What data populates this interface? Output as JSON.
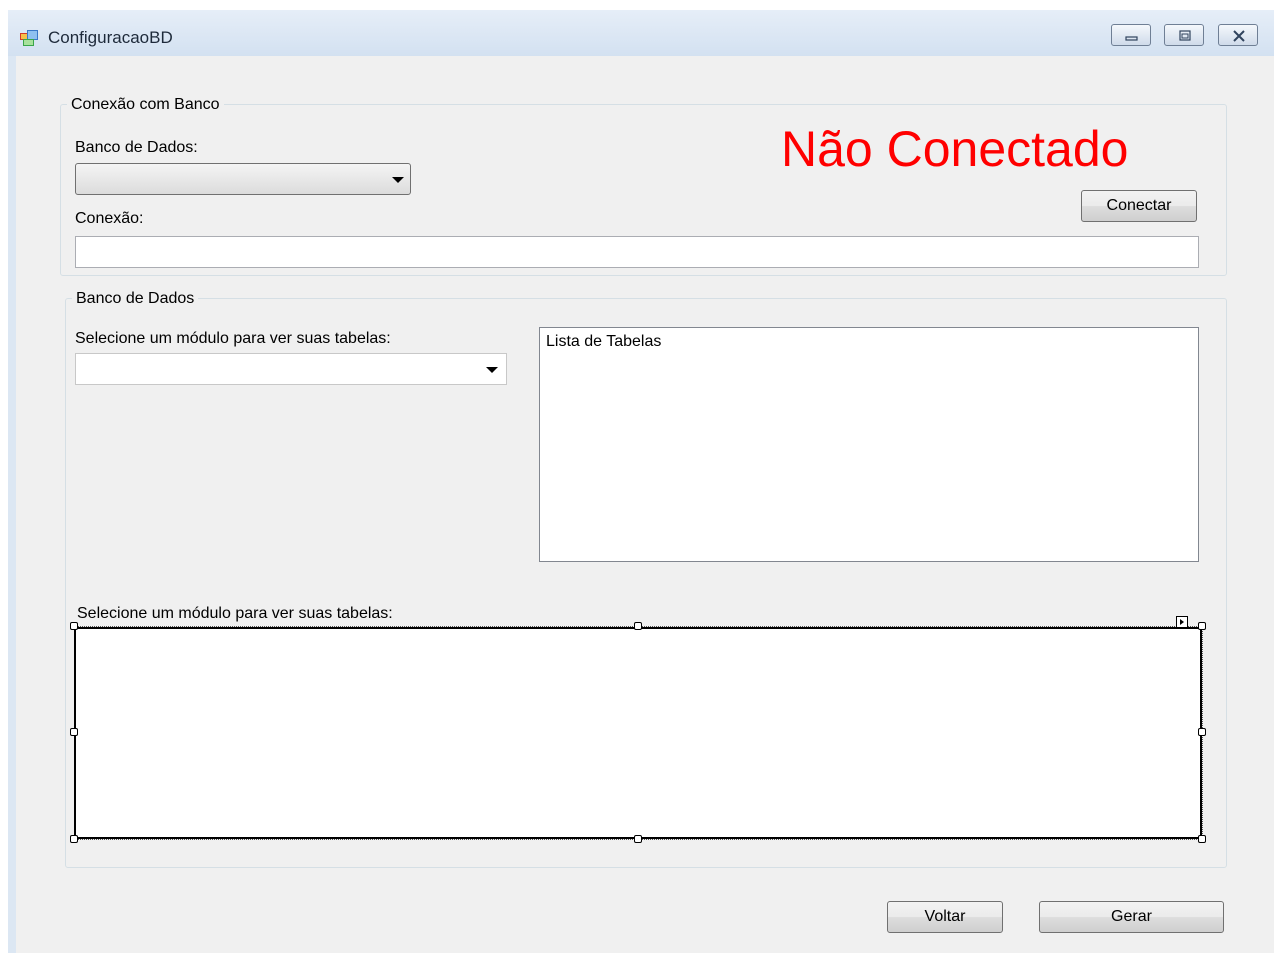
{
  "window": {
    "title": "ConfiguracaoBD"
  },
  "connection_group": {
    "title": "Conexão com Banco",
    "database_label": "Banco de Dados:",
    "database_value": "",
    "connection_label": "Conexão:",
    "connection_value": "",
    "status_text": "Não Conectado",
    "status_color": "#ff0000",
    "connect_button": "Conectar"
  },
  "database_group": {
    "title": "Banco de Dados",
    "module_label": "Selecione um módulo para ver suas tabelas:",
    "module_value": "",
    "tables_list": [
      "Lista de Tabelas"
    ],
    "grid_label": "Selecione um módulo para ver suas tabelas:"
  },
  "footer": {
    "back_button": "Voltar",
    "generate_button": "Gerar"
  }
}
